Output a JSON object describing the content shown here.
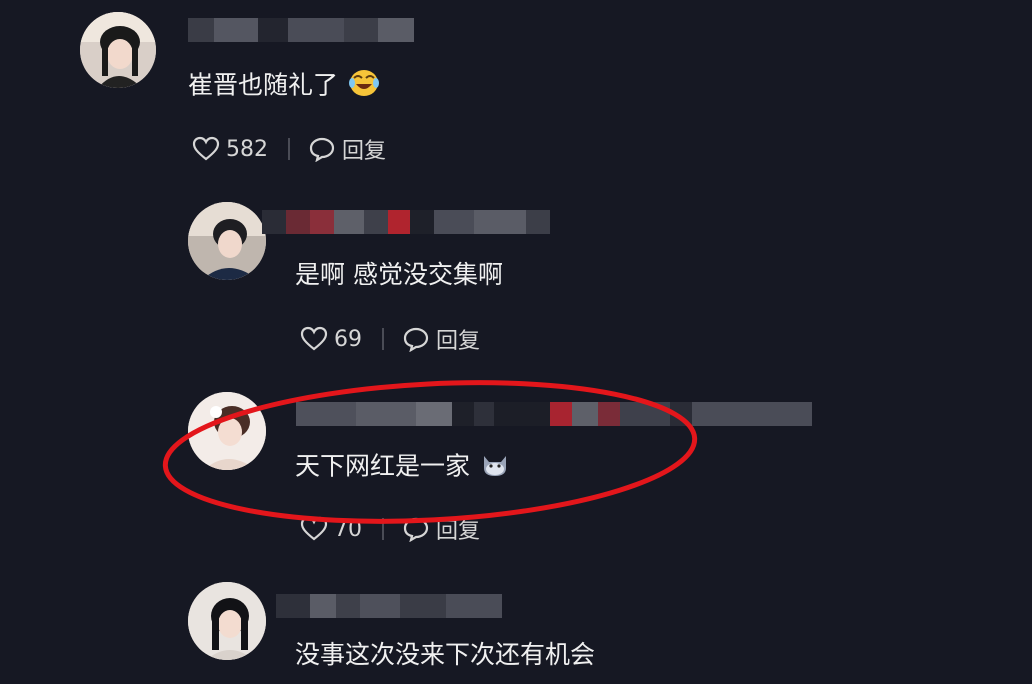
{
  "comments": [
    {
      "text": "崔晋也随礼了",
      "emoji_icon": "laughing-tears-emoji",
      "likes": "582",
      "reply_label": "回复"
    },
    {
      "text": "是啊 感觉没交集啊",
      "likes": "69",
      "reply_label": "回复"
    },
    {
      "text": "天下网红是一家",
      "emoji_icon": "cat-emoji",
      "likes": "70",
      "reply_label": "回复",
      "highlighted": true
    },
    {
      "text": "没事这次没来下次还有机会"
    }
  ],
  "colors": {
    "background": "#161823",
    "highlight_circle": "#e3161b",
    "text": "#f0f0f0",
    "meta": "#d6d6d6"
  }
}
